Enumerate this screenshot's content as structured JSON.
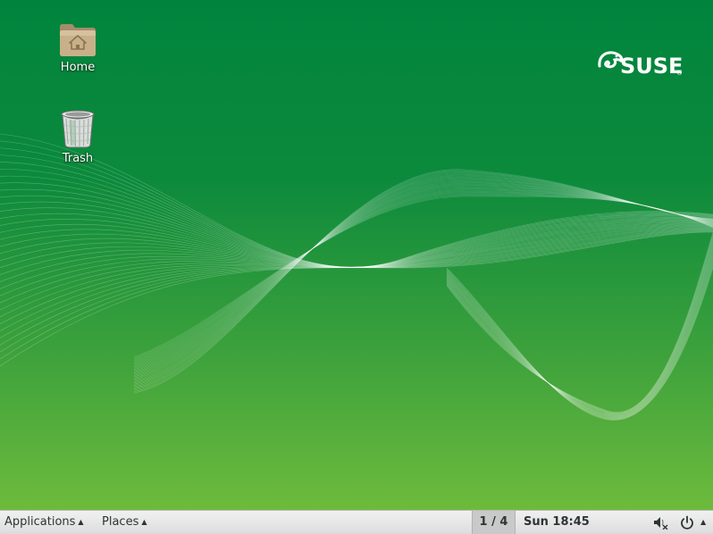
{
  "desktop": {
    "icons": [
      {
        "label": "Home"
      },
      {
        "label": "Trash"
      }
    ],
    "logo": {
      "text": "SUSE",
      "mark": "®"
    }
  },
  "panel": {
    "applications_label": "Applications",
    "places_label": "Places",
    "workspace": "1 / 4",
    "clock": "Sun 18:45",
    "menu_arrow": "▲"
  },
  "colors": {
    "desktop_top": "#00843d",
    "desktop_bottom": "#6dbb3c",
    "panel_bg": "#e6e6e6"
  },
  "icons": {
    "home": "home-folder-icon",
    "trash": "trash-icon",
    "volume": "volume-muted-icon",
    "power": "power-icon"
  }
}
